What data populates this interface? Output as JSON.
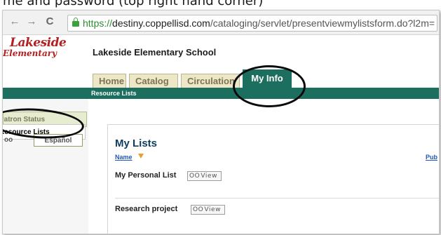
{
  "caption": "me and password (top right hand corner)",
  "browser": {
    "url_scheme": "https://",
    "url_host": "destiny.coppellisd.com",
    "url_path": "/cataloging/servlet/presentviewmylistsform.do?l2m=",
    "back_icon": "back-arrow-icon",
    "forward_icon": "forward-arrow-icon",
    "reload_icon": "reload-icon"
  },
  "logo": {
    "line1": "Lakeside",
    "line2": "Elementary"
  },
  "school_name": "Lakeside Elementary School",
  "tabs": [
    {
      "label": "Home"
    },
    {
      "label": "Catalog"
    },
    {
      "label": "Circulation"
    },
    {
      "label": "My Info",
      "active": true
    }
  ],
  "subnav": {
    "label": "Resource Lists"
  },
  "sidebar": {
    "items": [
      {
        "label": "Patron Status"
      },
      {
        "label": "Resource Lists",
        "active": true
      }
    ],
    "lang_prefix": "oo",
    "lang_button": "Español"
  },
  "content": {
    "title": "My Lists",
    "col_name": "Name",
    "col_public": "Pub",
    "lists": [
      {
        "name": "My Personal List",
        "view_label": "View"
      },
      {
        "name": "Research project",
        "view_label": "View"
      }
    ]
  },
  "colors": {
    "brand_green": "#1c6f5e",
    "logo_red": "#b51f1f",
    "link_blue": "#1f57b8",
    "title_navy": "#0d3d5e"
  }
}
